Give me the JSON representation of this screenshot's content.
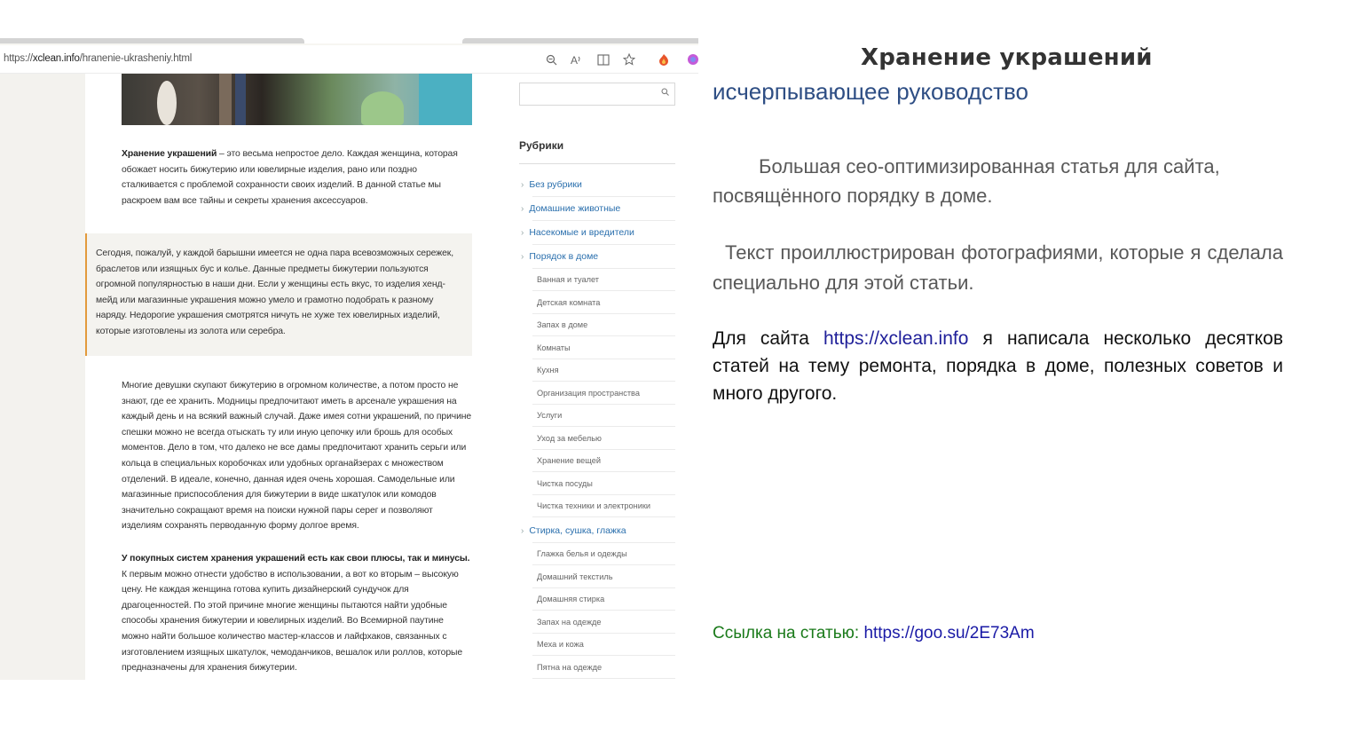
{
  "browser": {
    "url_prefix": "https://",
    "url_host": "xclean.info",
    "url_path": "/hranenie-ukrasheniy.html",
    "icons": [
      "zoom-icon",
      "read-aloud-icon",
      "reader-view-icon",
      "favorite-star-icon",
      "extension-icon",
      "profile-icon"
    ]
  },
  "article": {
    "intro_bold": "Хранение украшений",
    "intro_rest": " – это весьма непростое дело. Каждая женщина, которая обожает носить бижутерию или ювелирные изделия, рано или поздно сталкивается с проблемой сохранности своих изделий. В данной статье мы раскроем вам все тайны и секреты хранения аксессуаров.",
    "quote": "Сегодня, пожалуй, у каждой барышни имеется не одна пара всевозможных сережек, браслетов или изящных бус и колье. Данные предметы бижутерии пользуются огромной популярностью в наши дни. Если у женщины есть вкус, то изделия хенд-мейд или магазинные украшения можно умело и грамотно подобрать к разному наряду. Недорогие украшения смотрятся ничуть не хуже тех ювелирных изделий, которые изготовлены из золота или серебра.",
    "body1": "Многие девушки скупают бижутерию в огромном количестве, а потом просто не знают, где ее хранить. Модницы предпочитают иметь в арсенале украшения на каждый день и на всякий важный случай. Даже имея сотни украшений, по причине спешки можно не всегда отыскать ту или иную цепочку или брошь для особых моментов. Дело в том, что далеко не все дамы предпочитают хранить серьги или кольца в специальных коробочках или удобных органайзерах с множеством отделений. В идеале, конечно, данная идея очень хорошая. Самодельные или магазинные приспособления для бижутерии в виде шкатулок или комодов значительно сокращают время на поиски нужной пары серег и позволяют изделиям сохранять перводанную форму долгое время.",
    "body2_bold": "У покупных систем хранения украшений есть как свои плюсы, так и минусы.",
    "body2_rest": " К первым можно отнести удобство в использовании, а вот ко вторым – высокую цену. Не каждая женщина готова купить дизайнерский сундучок для драгоценностей. По этой причине многие женщины пытаются найти удобные способы хранения бижутерии и ювелирных изделий. Во Всемирной паутине можно найти большое количество мастер-классов и лайфхаков, связанных с изготовлением изящных шкатулок, чемоданчиков, вешалок или роллов, которые предназначены для хранения бижутерии."
  },
  "sidebar": {
    "title": "Рубрики",
    "categories": [
      {
        "label": "Без рубрики",
        "level": "main"
      },
      {
        "label": "Домашние животные",
        "level": "main"
      },
      {
        "label": "Насекомые и вредители",
        "level": "main"
      },
      {
        "label": "Порядок в доме",
        "level": "main"
      },
      {
        "label": "Ванная и туалет",
        "level": "sub"
      },
      {
        "label": "Детская комната",
        "level": "sub"
      },
      {
        "label": "Запах в доме",
        "level": "sub"
      },
      {
        "label": "Комнаты",
        "level": "sub"
      },
      {
        "label": "Кухня",
        "level": "sub"
      },
      {
        "label": "Организация пространства",
        "level": "sub"
      },
      {
        "label": "Услуги",
        "level": "sub"
      },
      {
        "label": "Уход за мебелью",
        "level": "sub"
      },
      {
        "label": "Хранение вещей",
        "level": "sub"
      },
      {
        "label": "Чистка посуды",
        "level": "sub"
      },
      {
        "label": "Чистка техники и электроники",
        "level": "sub"
      },
      {
        "label": "Стирка, сушка, глажка",
        "level": "main"
      },
      {
        "label": "Глажка белья и одежды",
        "level": "sub"
      },
      {
        "label": "Домашний текстиль",
        "level": "sub"
      },
      {
        "label": "Домашняя стирка",
        "level": "sub"
      },
      {
        "label": "Запах на одежде",
        "level": "sub"
      },
      {
        "label": "Меха и кожа",
        "level": "sub"
      },
      {
        "label": "Пятна на одежде",
        "level": "sub"
      }
    ]
  },
  "slide": {
    "title": "Хранение украшений",
    "subtitle": "исчерпывающее руководство",
    "p1": "Большая сео-оптимизированная статья для сайта, посвящённого порядку в доме.",
    "p2": "Текст проиллюстрирован фотографиями, которые я сделала специально для этой статьи.",
    "p3_before": "Для сайта ",
    "p3_link": "https://xclean.info",
    "p3_after": " я написала несколько десятков статей на тему ремонта, порядка в доме, полезных советов и много другого.",
    "link_label": "Ссылка на статью: ",
    "link_url": "https://goo.su/2E73Am"
  },
  "colors": {
    "title": "#333333",
    "subtitle": "#2e4e84",
    "link_label": "#1a7a1a",
    "link_url": "#1a1aa6",
    "quote_border": "#e39a3c",
    "sidebar_link": "#2a6fad"
  }
}
